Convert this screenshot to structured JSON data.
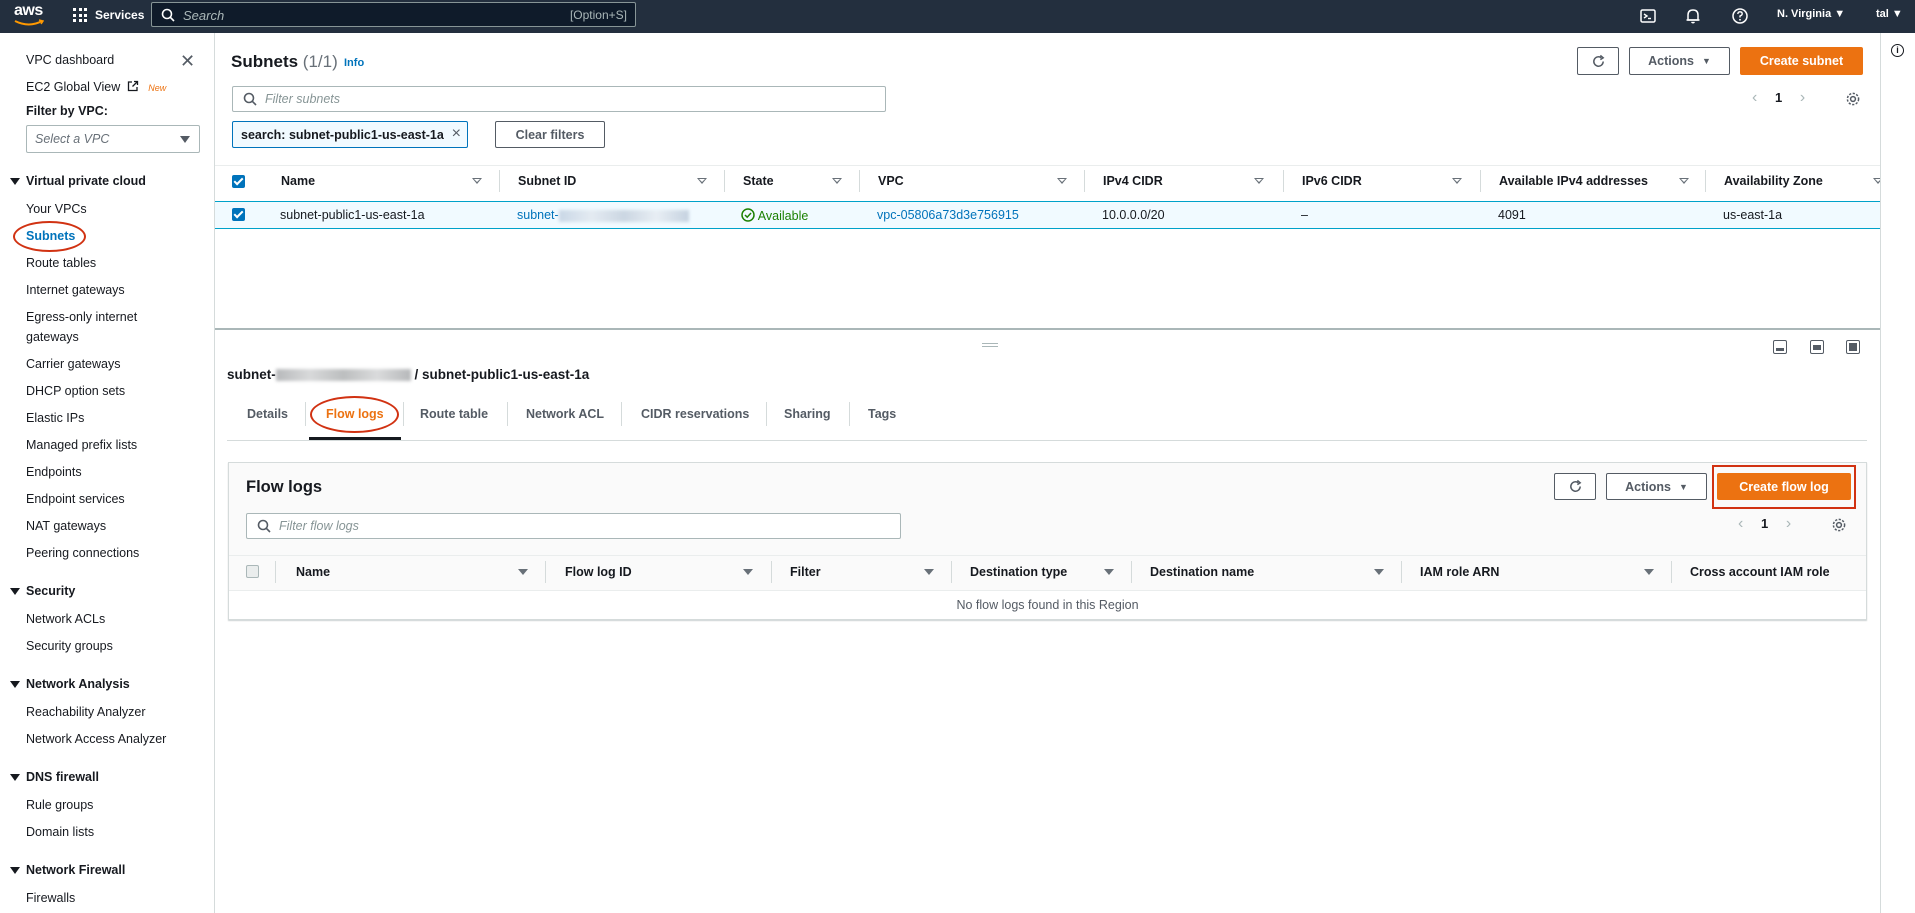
{
  "topnav": {
    "logo": "aws",
    "services_label": "Services",
    "search_placeholder": "Search",
    "search_shortcut": "[Option+S]",
    "region": "N. Virginia ▼",
    "user": "tal ▼",
    "icons": [
      "cloudshell-icon",
      "bell-icon",
      "help-icon"
    ]
  },
  "sidebar": {
    "vpc_dashboard": "VPC dashboard",
    "ec2_global_view": "EC2 Global View",
    "new_badge": "New",
    "filter_label": "Filter by VPC:",
    "filter_placeholder": "Select a VPC",
    "sections": {
      "vpc": "Virtual private cloud",
      "security": "Security",
      "network_analysis": "Network Analysis",
      "dns_firewall": "DNS firewall",
      "network_firewall": "Network Firewall"
    },
    "vpc_items": [
      "Your VPCs",
      "Subnets",
      "Route tables",
      "Internet gateways",
      "Egress-only internet",
      "gateways",
      "Carrier gateways",
      "DHCP option sets",
      "Elastic IPs",
      "Managed prefix lists",
      "Endpoints",
      "Endpoint services",
      "NAT gateways",
      "Peering connections"
    ],
    "security_items": [
      "Network ACLs",
      "Security groups"
    ],
    "analysis_items": [
      "Reachability Analyzer",
      "Network Access Analyzer"
    ],
    "dns_items": [
      "Rule groups",
      "Domain lists"
    ],
    "firewall_items": [
      "Firewalls"
    ]
  },
  "subnets": {
    "title": "Subnets",
    "count": "(1/1)",
    "info": "Info",
    "actions_label": "Actions",
    "create_label": "Create subnet",
    "filter_placeholder": "Filter subnets",
    "page": "1",
    "token": "search: subnet-public1-us-east-1a",
    "clear_filters": "Clear filters",
    "columns": [
      "Name",
      "Subnet ID",
      "State",
      "VPC",
      "IPv4 CIDR",
      "IPv6 CIDR",
      "Available IPv4 addresses",
      "Availability Zone"
    ],
    "row": {
      "name": "subnet-public1-us-east-1a",
      "subnet_id_prefix": "subnet-",
      "state": "Available",
      "vpc": "vpc-05806a73d3e756915",
      "ipv4": "10.0.0.0/20",
      "ipv6": "–",
      "available": "4091",
      "az": "us-east-1a"
    }
  },
  "detail": {
    "title_prefix": "subnet-",
    "title_suffix": " / subnet-public1-us-east-1a",
    "tabs": [
      "Details",
      "Flow logs",
      "Route table",
      "Network ACL",
      "CIDR reservations",
      "Sharing",
      "Tags"
    ],
    "active_tab": "Flow logs"
  },
  "flow_logs": {
    "title": "Flow logs",
    "actions_label": "Actions",
    "create_label": "Create flow log",
    "filter_placeholder": "Filter flow logs",
    "page": "1",
    "columns": [
      "Name",
      "Flow log ID",
      "Filter",
      "Destination type",
      "Destination name",
      "IAM role ARN",
      "Cross account IAM role"
    ],
    "empty": "No flow logs found in this Region"
  },
  "colors": {
    "nav_bg": "#232f3e",
    "primary": "#ec7211",
    "link": "#0073bb",
    "success": "#1d8102",
    "highlight": "#d13212"
  }
}
